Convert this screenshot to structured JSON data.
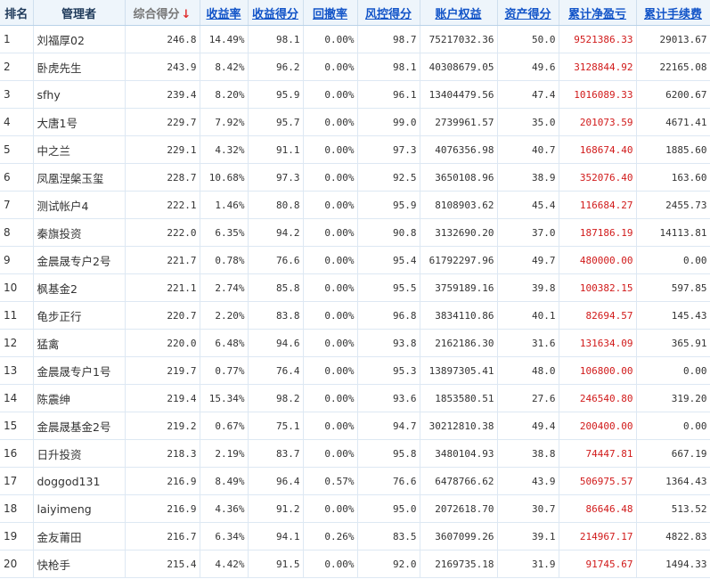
{
  "table": {
    "headers": {
      "rank": "排名",
      "manager": "管理者",
      "total_score": "综合得分",
      "return_rate": "收益率",
      "return_score": "收益得分",
      "drawdown": "回撤率",
      "risk_score": "风控得分",
      "equity": "账户权益",
      "asset_score": "资产得分",
      "net_profit": "累计净盈亏",
      "fees": "累计手续费"
    },
    "sort_arrow": "↓",
    "colors": {
      "link_header": "#1254c8",
      "profit_text": "#d11a1a",
      "header_bg": "#eef5fb",
      "sort_arrow": "#e03030"
    },
    "rows": [
      {
        "rank": "1",
        "manager": "刘福厚02",
        "total_score": "246.8",
        "return_rate": "14.49%",
        "return_score": "98.1",
        "drawdown": "0.00%",
        "risk_score": "98.7",
        "equity": "75217032.36",
        "asset_score": "50.0",
        "net_profit": "9521386.33",
        "fees": "29013.67"
      },
      {
        "rank": "2",
        "manager": "卧虎先生",
        "total_score": "243.9",
        "return_rate": "8.42%",
        "return_score": "96.2",
        "drawdown": "0.00%",
        "risk_score": "98.1",
        "equity": "40308679.05",
        "asset_score": "49.6",
        "net_profit": "3128844.92",
        "fees": "22165.08"
      },
      {
        "rank": "3",
        "manager": "sfhy",
        "total_score": "239.4",
        "return_rate": "8.20%",
        "return_score": "95.9",
        "drawdown": "0.00%",
        "risk_score": "96.1",
        "equity": "13404479.56",
        "asset_score": "47.4",
        "net_profit": "1016089.33",
        "fees": "6200.67"
      },
      {
        "rank": "4",
        "manager": "大唐1号",
        "total_score": "229.7",
        "return_rate": "7.92%",
        "return_score": "95.7",
        "drawdown": "0.00%",
        "risk_score": "99.0",
        "equity": "2739961.57",
        "asset_score": "35.0",
        "net_profit": "201073.59",
        "fees": "4671.41"
      },
      {
        "rank": "5",
        "manager": "中之兰",
        "total_score": "229.1",
        "return_rate": "4.32%",
        "return_score": "91.1",
        "drawdown": "0.00%",
        "risk_score": "97.3",
        "equity": "4076356.98",
        "asset_score": "40.7",
        "net_profit": "168674.40",
        "fees": "1885.60"
      },
      {
        "rank": "6",
        "manager": "凤凰涅槃玉玺",
        "total_score": "228.7",
        "return_rate": "10.68%",
        "return_score": "97.3",
        "drawdown": "0.00%",
        "risk_score": "92.5",
        "equity": "3650108.96",
        "asset_score": "38.9",
        "net_profit": "352076.40",
        "fees": "163.60"
      },
      {
        "rank": "7",
        "manager": "测试帐户4",
        "total_score": "222.1",
        "return_rate": "1.46%",
        "return_score": "80.8",
        "drawdown": "0.00%",
        "risk_score": "95.9",
        "equity": "8108903.62",
        "asset_score": "45.4",
        "net_profit": "116684.27",
        "fees": "2455.73"
      },
      {
        "rank": "8",
        "manager": "秦旗投资",
        "total_score": "222.0",
        "return_rate": "6.35%",
        "return_score": "94.2",
        "drawdown": "0.00%",
        "risk_score": "90.8",
        "equity": "3132690.20",
        "asset_score": "37.0",
        "net_profit": "187186.19",
        "fees": "14113.81"
      },
      {
        "rank": "9",
        "manager": "金晨晟专户2号",
        "total_score": "221.7",
        "return_rate": "0.78%",
        "return_score": "76.6",
        "drawdown": "0.00%",
        "risk_score": "95.4",
        "equity": "61792297.96",
        "asset_score": "49.7",
        "net_profit": "480000.00",
        "fees": "0.00"
      },
      {
        "rank": "10",
        "manager": "枫基金2",
        "total_score": "221.1",
        "return_rate": "2.74%",
        "return_score": "85.8",
        "drawdown": "0.00%",
        "risk_score": "95.5",
        "equity": "3759189.16",
        "asset_score": "39.8",
        "net_profit": "100382.15",
        "fees": "597.85"
      },
      {
        "rank": "11",
        "manager": "龟步正行",
        "total_score": "220.7",
        "return_rate": "2.20%",
        "return_score": "83.8",
        "drawdown": "0.00%",
        "risk_score": "96.8",
        "equity": "3834110.86",
        "asset_score": "40.1",
        "net_profit": "82694.57",
        "fees": "145.43"
      },
      {
        "rank": "12",
        "manager": "猛禽",
        "total_score": "220.0",
        "return_rate": "6.48%",
        "return_score": "94.6",
        "drawdown": "0.00%",
        "risk_score": "93.8",
        "equity": "2162186.30",
        "asset_score": "31.6",
        "net_profit": "131634.09",
        "fees": "365.91"
      },
      {
        "rank": "13",
        "manager": "金晨晟专户1号",
        "total_score": "219.7",
        "return_rate": "0.77%",
        "return_score": "76.4",
        "drawdown": "0.00%",
        "risk_score": "95.3",
        "equity": "13897305.41",
        "asset_score": "48.0",
        "net_profit": "106800.00",
        "fees": "0.00"
      },
      {
        "rank": "14",
        "manager": "陈震绅",
        "total_score": "219.4",
        "return_rate": "15.34%",
        "return_score": "98.2",
        "drawdown": "0.00%",
        "risk_score": "93.6",
        "equity": "1853580.51",
        "asset_score": "27.6",
        "net_profit": "246540.80",
        "fees": "319.20"
      },
      {
        "rank": "15",
        "manager": "金晨晟基金2号",
        "total_score": "219.2",
        "return_rate": "0.67%",
        "return_score": "75.1",
        "drawdown": "0.00%",
        "risk_score": "94.7",
        "equity": "30212810.38",
        "asset_score": "49.4",
        "net_profit": "200400.00",
        "fees": "0.00"
      },
      {
        "rank": "16",
        "manager": "日升投资",
        "total_score": "218.3",
        "return_rate": "2.19%",
        "return_score": "83.7",
        "drawdown": "0.00%",
        "risk_score": "95.8",
        "equity": "3480104.93",
        "asset_score": "38.8",
        "net_profit": "74447.81",
        "fees": "667.19"
      },
      {
        "rank": "17",
        "manager": "doggod131",
        "total_score": "216.9",
        "return_rate": "8.49%",
        "return_score": "96.4",
        "drawdown": "0.57%",
        "risk_score": "76.6",
        "equity": "6478766.62",
        "asset_score": "43.9",
        "net_profit": "506975.57",
        "fees": "1364.43"
      },
      {
        "rank": "18",
        "manager": "laiyimeng",
        "total_score": "216.9",
        "return_rate": "4.36%",
        "return_score": "91.2",
        "drawdown": "0.00%",
        "risk_score": "95.0",
        "equity": "2072618.70",
        "asset_score": "30.7",
        "net_profit": "86646.48",
        "fees": "513.52"
      },
      {
        "rank": "19",
        "manager": "金友莆田",
        "total_score": "216.7",
        "return_rate": "6.34%",
        "return_score": "94.1",
        "drawdown": "0.26%",
        "risk_score": "83.5",
        "equity": "3607099.26",
        "asset_score": "39.1",
        "net_profit": "214967.17",
        "fees": "4822.83"
      },
      {
        "rank": "20",
        "manager": "快枪手",
        "total_score": "215.4",
        "return_rate": "4.42%",
        "return_score": "91.5",
        "drawdown": "0.00%",
        "risk_score": "92.0",
        "equity": "2169735.18",
        "asset_score": "31.9",
        "net_profit": "91745.67",
        "fees": "1494.33"
      }
    ]
  }
}
